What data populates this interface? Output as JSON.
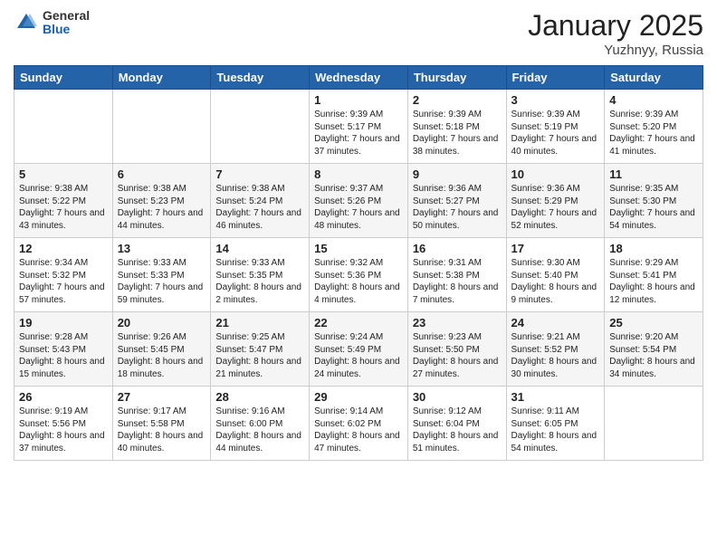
{
  "logo": {
    "general": "General",
    "blue": "Blue"
  },
  "title": "January 2025",
  "location": "Yuzhnyy, Russia",
  "days_header": [
    "Sunday",
    "Monday",
    "Tuesday",
    "Wednesday",
    "Thursday",
    "Friday",
    "Saturday"
  ],
  "weeks": [
    [
      {
        "day": "",
        "info": ""
      },
      {
        "day": "",
        "info": ""
      },
      {
        "day": "",
        "info": ""
      },
      {
        "day": "1",
        "info": "Sunrise: 9:39 AM\nSunset: 5:17 PM\nDaylight: 7 hours and 37 minutes."
      },
      {
        "day": "2",
        "info": "Sunrise: 9:39 AM\nSunset: 5:18 PM\nDaylight: 7 hours and 38 minutes."
      },
      {
        "day": "3",
        "info": "Sunrise: 9:39 AM\nSunset: 5:19 PM\nDaylight: 7 hours and 40 minutes."
      },
      {
        "day": "4",
        "info": "Sunrise: 9:39 AM\nSunset: 5:20 PM\nDaylight: 7 hours and 41 minutes."
      }
    ],
    [
      {
        "day": "5",
        "info": "Sunrise: 9:38 AM\nSunset: 5:22 PM\nDaylight: 7 hours and 43 minutes."
      },
      {
        "day": "6",
        "info": "Sunrise: 9:38 AM\nSunset: 5:23 PM\nDaylight: 7 hours and 44 minutes."
      },
      {
        "day": "7",
        "info": "Sunrise: 9:38 AM\nSunset: 5:24 PM\nDaylight: 7 hours and 46 minutes."
      },
      {
        "day": "8",
        "info": "Sunrise: 9:37 AM\nSunset: 5:26 PM\nDaylight: 7 hours and 48 minutes."
      },
      {
        "day": "9",
        "info": "Sunrise: 9:36 AM\nSunset: 5:27 PM\nDaylight: 7 hours and 50 minutes."
      },
      {
        "day": "10",
        "info": "Sunrise: 9:36 AM\nSunset: 5:29 PM\nDaylight: 7 hours and 52 minutes."
      },
      {
        "day": "11",
        "info": "Sunrise: 9:35 AM\nSunset: 5:30 PM\nDaylight: 7 hours and 54 minutes."
      }
    ],
    [
      {
        "day": "12",
        "info": "Sunrise: 9:34 AM\nSunset: 5:32 PM\nDaylight: 7 hours and 57 minutes."
      },
      {
        "day": "13",
        "info": "Sunrise: 9:33 AM\nSunset: 5:33 PM\nDaylight: 7 hours and 59 minutes."
      },
      {
        "day": "14",
        "info": "Sunrise: 9:33 AM\nSunset: 5:35 PM\nDaylight: 8 hours and 2 minutes."
      },
      {
        "day": "15",
        "info": "Sunrise: 9:32 AM\nSunset: 5:36 PM\nDaylight: 8 hours and 4 minutes."
      },
      {
        "day": "16",
        "info": "Sunrise: 9:31 AM\nSunset: 5:38 PM\nDaylight: 8 hours and 7 minutes."
      },
      {
        "day": "17",
        "info": "Sunrise: 9:30 AM\nSunset: 5:40 PM\nDaylight: 8 hours and 9 minutes."
      },
      {
        "day": "18",
        "info": "Sunrise: 9:29 AM\nSunset: 5:41 PM\nDaylight: 8 hours and 12 minutes."
      }
    ],
    [
      {
        "day": "19",
        "info": "Sunrise: 9:28 AM\nSunset: 5:43 PM\nDaylight: 8 hours and 15 minutes."
      },
      {
        "day": "20",
        "info": "Sunrise: 9:26 AM\nSunset: 5:45 PM\nDaylight: 8 hours and 18 minutes."
      },
      {
        "day": "21",
        "info": "Sunrise: 9:25 AM\nSunset: 5:47 PM\nDaylight: 8 hours and 21 minutes."
      },
      {
        "day": "22",
        "info": "Sunrise: 9:24 AM\nSunset: 5:49 PM\nDaylight: 8 hours and 24 minutes."
      },
      {
        "day": "23",
        "info": "Sunrise: 9:23 AM\nSunset: 5:50 PM\nDaylight: 8 hours and 27 minutes."
      },
      {
        "day": "24",
        "info": "Sunrise: 9:21 AM\nSunset: 5:52 PM\nDaylight: 8 hours and 30 minutes."
      },
      {
        "day": "25",
        "info": "Sunrise: 9:20 AM\nSunset: 5:54 PM\nDaylight: 8 hours and 34 minutes."
      }
    ],
    [
      {
        "day": "26",
        "info": "Sunrise: 9:19 AM\nSunset: 5:56 PM\nDaylight: 8 hours and 37 minutes."
      },
      {
        "day": "27",
        "info": "Sunrise: 9:17 AM\nSunset: 5:58 PM\nDaylight: 8 hours and 40 minutes."
      },
      {
        "day": "28",
        "info": "Sunrise: 9:16 AM\nSunset: 6:00 PM\nDaylight: 8 hours and 44 minutes."
      },
      {
        "day": "29",
        "info": "Sunrise: 9:14 AM\nSunset: 6:02 PM\nDaylight: 8 hours and 47 minutes."
      },
      {
        "day": "30",
        "info": "Sunrise: 9:12 AM\nSunset: 6:04 PM\nDaylight: 8 hours and 51 minutes."
      },
      {
        "day": "31",
        "info": "Sunrise: 9:11 AM\nSunset: 6:05 PM\nDaylight: 8 hours and 54 minutes."
      },
      {
        "day": "",
        "info": ""
      }
    ]
  ]
}
